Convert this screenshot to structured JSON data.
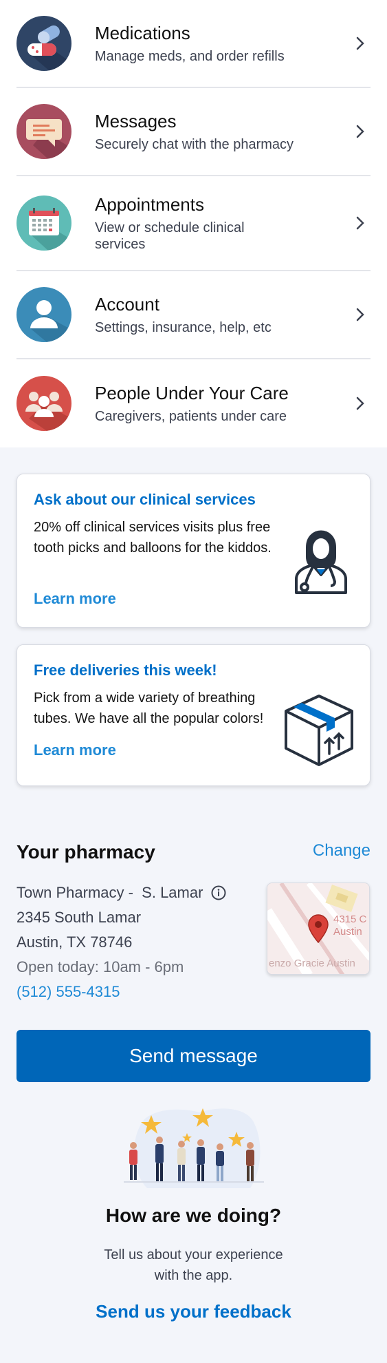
{
  "menu": [
    {
      "title": "Medications",
      "subtitle": "Manage meds, and order refills",
      "icon": "pills-icon",
      "color": "#2f4566"
    },
    {
      "title": "Messages",
      "subtitle": "Securely chat with the pharmacy",
      "icon": "chat-bubble-icon",
      "color": "#a84d5f"
    },
    {
      "title": "Appointments",
      "subtitle": "View or schedule clinical services",
      "icon": "calendar-icon",
      "color": "#5fbcb6"
    },
    {
      "title": "Account",
      "subtitle": "Settings, insurance, help, etc",
      "icon": "user-icon",
      "color": "#3b8cb8"
    },
    {
      "title": "People Under Your Care",
      "subtitle": "Caregivers, patients under care",
      "icon": "people-icon",
      "color": "#d6504a"
    }
  ],
  "promos": [
    {
      "title": "Ask about our clinical services",
      "body": "20% off clinical services visits plus free tooth picks and balloons for the kiddos.",
      "link": "Learn more",
      "icon": "doctor-icon"
    },
    {
      "title": "Free deliveries this week!",
      "body": "Pick from a wide variety of breathing tubes. We have all the popular colors!",
      "link": "Learn more",
      "icon": "package-icon"
    }
  ],
  "pharmacy": {
    "heading": "Your pharmacy",
    "change": "Change",
    "name": "Town Pharmacy -  S. Lamar",
    "address1": "2345 South Lamar",
    "address2": "Austin, TX 78746",
    "hours": "Open today: 10am - 6pm",
    "phone": "(512) 555-4315",
    "map_label1": "4315 C",
    "map_label2": "Austin",
    "map_label3": "enzo Gracie Austin"
  },
  "send_button": "Send message",
  "feedback": {
    "heading": "How are we doing?",
    "body_line1": "Tell us about your experience",
    "body_line2": "with the app.",
    "link": "Send us your feedback"
  },
  "colors": {
    "accent": "#0066b8",
    "link": "#1f8ad6",
    "background": "#f3f5fa"
  }
}
